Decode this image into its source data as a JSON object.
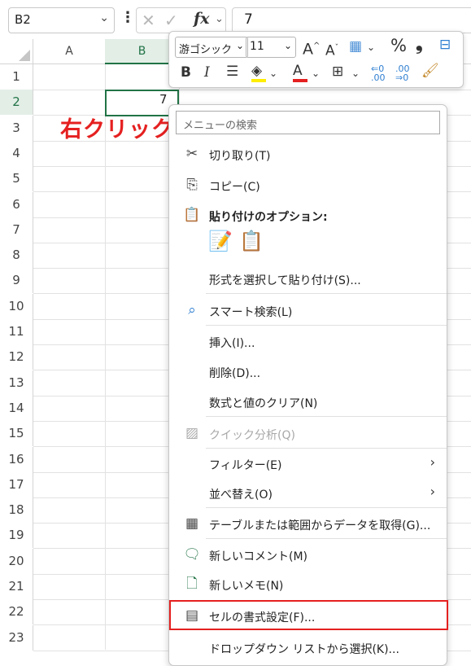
{
  "formula_bar": {
    "name_box": "B2",
    "fx": "fx",
    "value": "7"
  },
  "columns": [
    "A",
    "B"
  ],
  "rows": [
    "1",
    "2",
    "3",
    "4",
    "5",
    "6",
    "7",
    "8",
    "9",
    "10",
    "11",
    "12",
    "13",
    "14",
    "15",
    "16",
    "17",
    "18",
    "19",
    "20",
    "21",
    "22",
    "23"
  ],
  "cell_value": "7",
  "annotation": "右クリック",
  "mini_toolbar": {
    "font": "游ゴシック",
    "size": "11"
  },
  "menu": {
    "search_placeholder": "メニューの検索",
    "cut": "切り取り(T)",
    "copy": "コピー(C)",
    "paste_options": "貼り付けのオプション:",
    "paste_special": "形式を選択して貼り付け(S)...",
    "smart_lookup": "スマート検索(L)",
    "insert": "挿入(I)...",
    "delete": "削除(D)...",
    "clear": "数式と値のクリア(N)",
    "quick_analysis": "クイック分析(Q)",
    "filter": "フィルター(E)",
    "sort": "並べ替え(O)",
    "get_data": "テーブルまたは範囲からデータを取得(G)...",
    "new_comment": "新しいコメント(M)",
    "new_note": "新しいメモ(N)",
    "format_cells": "セルの書式設定(F)...",
    "dropdown": "ドロップダウン リストから選択(K)..."
  },
  "colors": {
    "accent": "#217346",
    "highlight": "#e52020"
  }
}
